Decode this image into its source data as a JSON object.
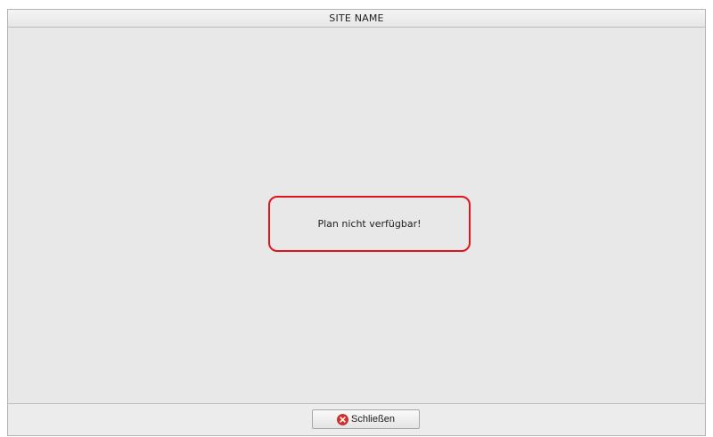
{
  "window": {
    "title": "SITE NAME"
  },
  "main": {
    "message": "Plan nicht verfügbar!"
  },
  "footer": {
    "close_label": "Schließen",
    "close_icon": "close-icon"
  },
  "colors": {
    "highlight_border": "#e0141c",
    "close_icon_fill": "#d9302a"
  }
}
